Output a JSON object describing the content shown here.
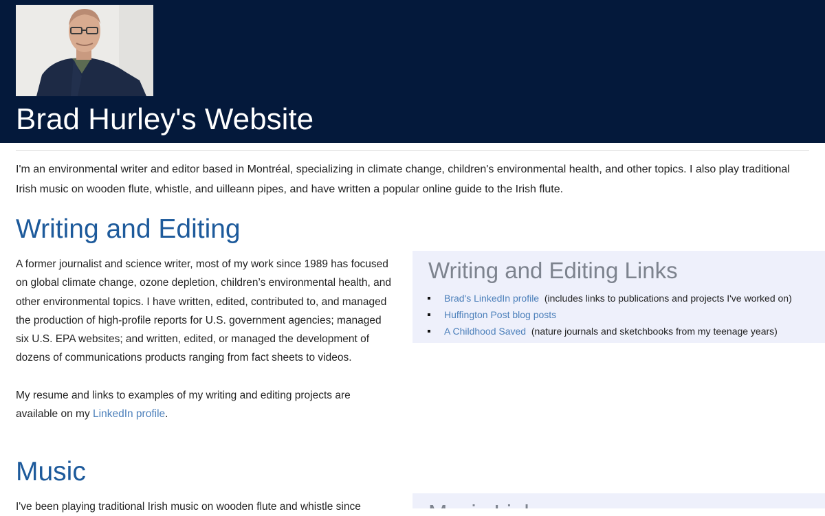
{
  "header": {
    "site_title": "Brad Hurley's Website",
    "portrait_alt": "Portrait photo"
  },
  "intro": "I'm an environmental writer and editor based in Montréal, specializing in climate change, children's environmental health, and other topics. I also play traditional Irish music on wooden flute, whistle, and uilleann pipes, and have written a popular online guide to the Irish flute.",
  "writing": {
    "title": "Writing and Editing",
    "para1": "A former journalist and science writer, most of my work since 1989 has focused on global climate change, ozone depletion, children’s environmental health, and other environmental topics. I have written, edited, contributed to, and managed the production of high-profile reports for U.S. government agencies; managed six U.S. EPA websites; and written, edited, or managed the development of dozens of communications products ranging from fact sheets to videos.",
    "para2_text": "My resume and links to examples of my writing and editing projects are available on my",
    "para2_link": "LinkedIn profile",
    "para2_end": ".",
    "links_title": "Writing and Editing Links",
    "links": [
      {
        "label": "Brad's LinkedIn profile",
        "note": "(includes links to publications and projects I've worked on)"
      },
      {
        "label": "Huffington Post blog posts",
        "note": ""
      },
      {
        "label": "A Childhood Saved",
        "note": "(nature journals and sketchbooks from my teenage years)"
      }
    ]
  },
  "music": {
    "title": "Music",
    "para1_partial": "I've been playing traditional Irish music on wooden flute and whistle since",
    "links_title_partial": "Music Links"
  },
  "colors": {
    "header_bg": "#04193b",
    "section_title": "#1d5a9b",
    "link": "#4b7fba",
    "links_box_bg": "#eef0fb",
    "links_title": "#7d838e"
  }
}
